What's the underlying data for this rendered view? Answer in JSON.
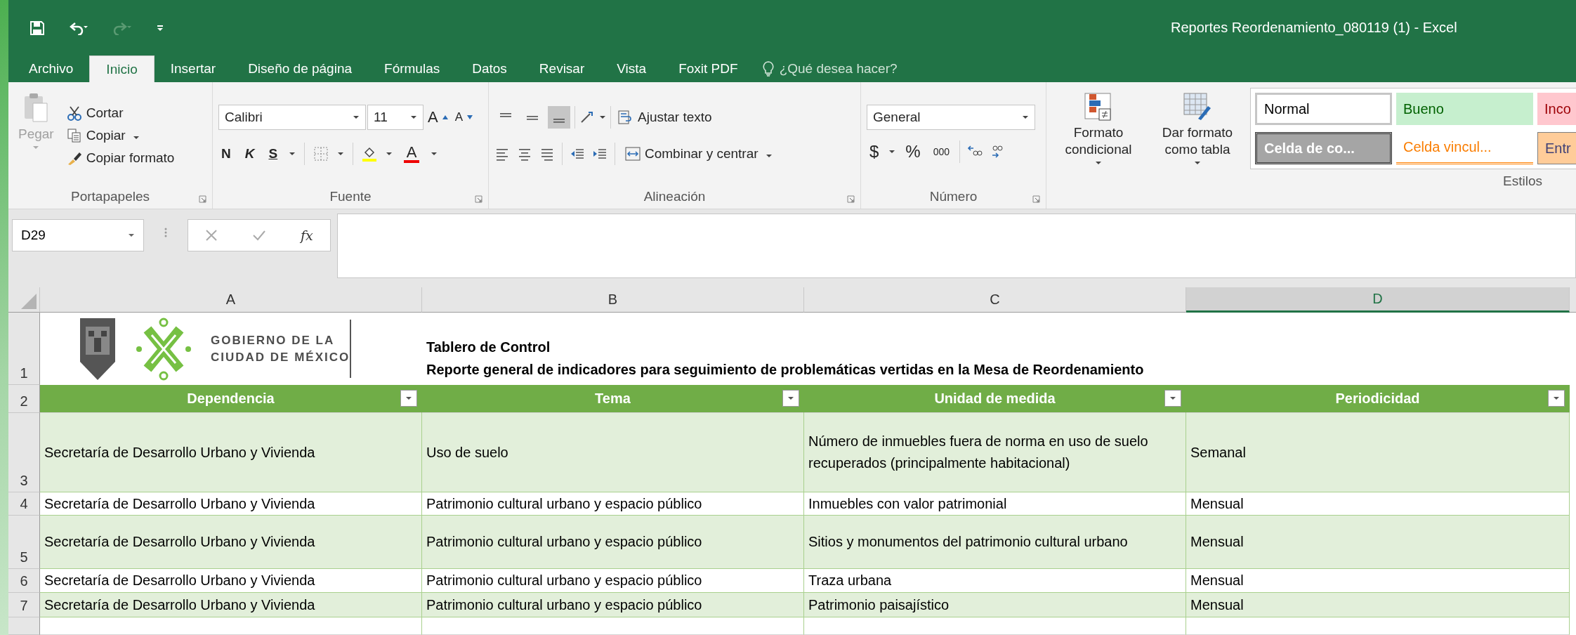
{
  "window": {
    "title": "Reportes Reordenamiento_080119 (1) - Excel"
  },
  "quick_access": [
    {
      "kind": "save",
      "disabled": false
    },
    {
      "kind": "undo",
      "disabled": false
    },
    {
      "kind": "redo",
      "disabled": true
    },
    {
      "kind": "customize",
      "disabled": false
    }
  ],
  "tabs": [
    {
      "label": "Archivo",
      "selected": false
    },
    {
      "label": "Inicio",
      "selected": true
    },
    {
      "label": "Insertar",
      "selected": false
    },
    {
      "label": "Diseño de página",
      "selected": false
    },
    {
      "label": "Fórmulas",
      "selected": false
    },
    {
      "label": "Datos",
      "selected": false
    },
    {
      "label": "Revisar",
      "selected": false
    },
    {
      "label": "Vista",
      "selected": false
    },
    {
      "label": "Foxit PDF",
      "selected": false
    }
  ],
  "tell_me": {
    "placeholder": "¿Qué desea hacer?"
  },
  "ribbon": {
    "clipboard": {
      "title": "Portapapeles",
      "paste": {
        "label": "Pegar",
        "disabled": true
      },
      "cut": "Cortar",
      "copy": "Copiar",
      "format_painter": "Copiar formato"
    },
    "font": {
      "title": "Fuente",
      "name": "Calibri",
      "size": "11",
      "size_buttons": [
        "A",
        "A"
      ],
      "styles": [
        "N",
        "K",
        "S"
      ],
      "font_color_label": "A"
    },
    "alignment": {
      "title": "Alineación",
      "vertical": [
        {
          "selected": false
        },
        {
          "selected": false
        },
        {
          "selected": true
        }
      ],
      "wrap": "Ajustar texto",
      "merge": "Combinar y centrar"
    },
    "number": {
      "title": "Número",
      "format": "General",
      "buttons": [
        "$",
        "%",
        "000"
      ]
    },
    "styles": {
      "title": "Estilos",
      "conditional": "Formato condicional",
      "as_table": "Dar formato como tabla",
      "gallery": [
        {
          "kind": "normal",
          "label": "Normal"
        },
        {
          "kind": "good",
          "label": "Bueno"
        },
        {
          "kind": "bad",
          "label": "Inco"
        },
        {
          "kind": "check",
          "label": "Celda de co..."
        },
        {
          "kind": "linked",
          "label": "Celda vincul..."
        },
        {
          "kind": "input",
          "label": "Entr"
        }
      ]
    }
  },
  "formula_bar": {
    "name_box": "D29",
    "function_label": "fx"
  },
  "sheet": {
    "columns": [
      {
        "label": "A",
        "selected": false
      },
      {
        "label": "B",
        "selected": false
      },
      {
        "label": "C",
        "selected": false
      },
      {
        "label": "D",
        "selected": true
      }
    ],
    "title_row": "1",
    "logo_lines": [
      "GOBIERNO DE LA",
      "CIUDAD DE MÉXICO"
    ],
    "title_lines": [
      "Tablero de Control",
      "Reporte general de indicadores para seguimiento de problemáticas vertidas en la Mesa de Reordenamiento"
    ],
    "header_row": "2",
    "table_headers": [
      "Dependencia",
      "Tema",
      "Unidad de medida",
      "Periodicidad"
    ],
    "rows": [
      {
        "number": "3",
        "cells": [
          "Secretaría de Desarrollo Urbano y Vivienda",
          "Uso de suelo",
          "Número de inmuebles fuera de norma en uso de suelo recuperados (principalmente habitacional)",
          "Semanal"
        ]
      },
      {
        "number": "4",
        "cells": [
          "Secretaría de Desarrollo Urbano y Vivienda",
          "Patrimonio cultural urbano y espacio público",
          "Inmuebles con valor patrimonial",
          "Mensual"
        ]
      },
      {
        "number": "5",
        "cells": [
          "Secretaría de Desarrollo Urbano y Vivienda",
          "Patrimonio cultural urbano y espacio público",
          "Sitios y monumentos del patrimonio cultural urbano",
          "Mensual"
        ]
      },
      {
        "number": "6",
        "cells": [
          "Secretaría de Desarrollo Urbano y Vivienda",
          "Patrimonio cultural urbano y espacio público",
          "Traza urbana",
          "Mensual"
        ]
      },
      {
        "number": "7",
        "cells": [
          "Secretaría de Desarrollo Urbano y Vivienda",
          "Patrimonio cultural urbano y espacio público",
          "Patrimonio paisajístico",
          "Mensual"
        ]
      }
    ]
  }
}
